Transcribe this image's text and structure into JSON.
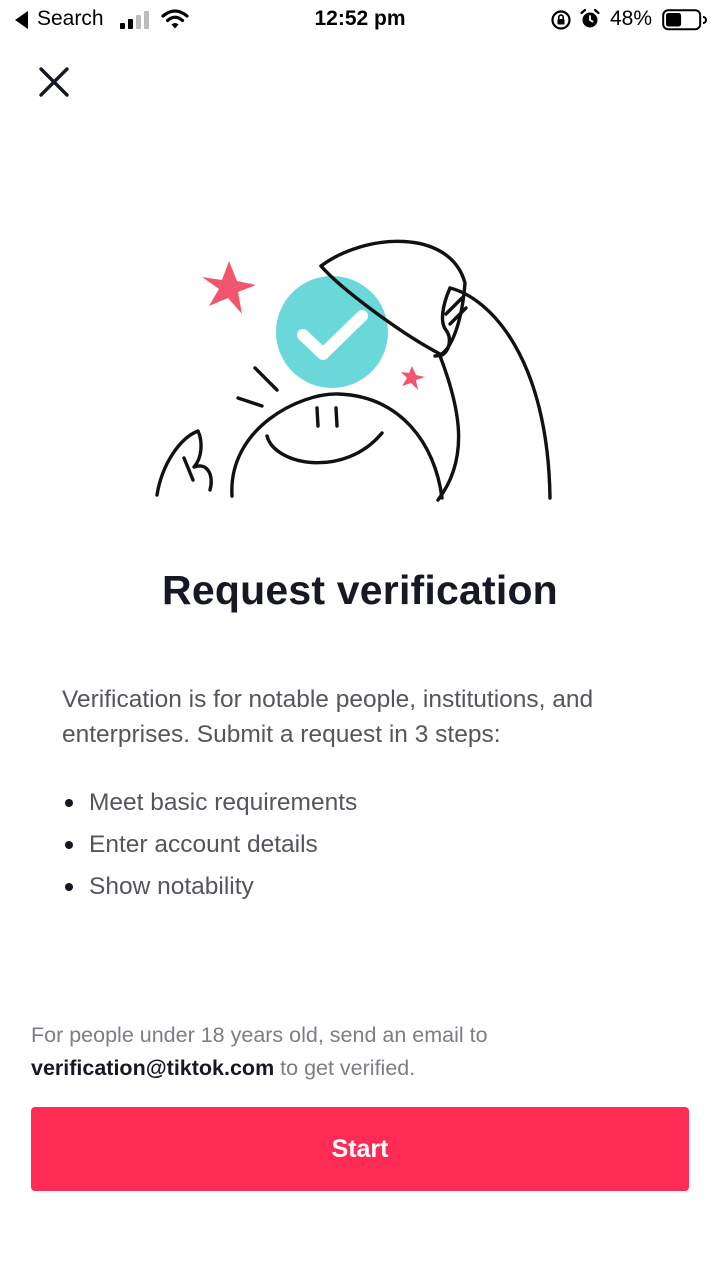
{
  "status_bar": {
    "back_label": "Search",
    "time": "12:52 pm",
    "battery_percent": "48%",
    "battery_level": 0.48,
    "icons": [
      "back-arrow-icon",
      "signal-icon",
      "wifi-icon",
      "rotation-lock-icon",
      "alarm-icon",
      "battery-icon"
    ]
  },
  "header": {
    "close_icon": "close-icon"
  },
  "main": {
    "title": "Request verification",
    "intro": "Verification is for notable people, institutions, and enterprises. Submit a request in 3 steps:",
    "steps": [
      "Meet basic requirements",
      "Enter account details",
      "Show notability"
    ]
  },
  "footer": {
    "note_prefix": "For people under 18 years old, send an email to",
    "email": "verification@tiktok.com",
    "note_suffix": "to get verified.",
    "start_label": "Start"
  },
  "colors": {
    "accent": "#fe2c55",
    "check_badge": "#6ad8d8",
    "star": "#f2566d",
    "text": "#161823",
    "muted": "#54565c"
  }
}
